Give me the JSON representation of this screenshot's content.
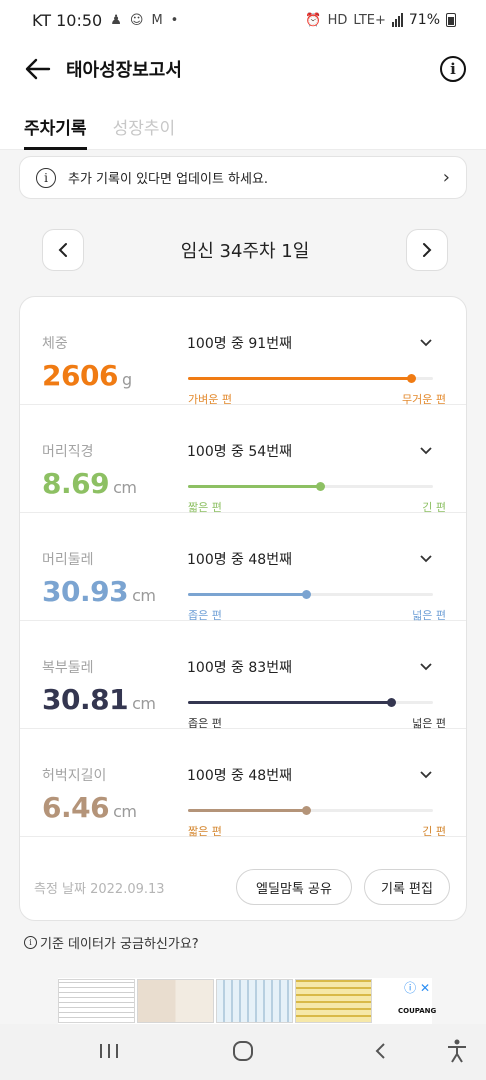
{
  "status_bar": {
    "carrier_time": "KT 10:50",
    "m_label": "M",
    "dot": "•",
    "lte": "LTE+",
    "battery": "71%"
  },
  "header": {
    "title": "태아성장보고서",
    "info": "i"
  },
  "tabs": [
    {
      "label": "주차기록",
      "active": true
    },
    {
      "label": "성장추이",
      "active": false
    }
  ],
  "notice": {
    "icon": "i",
    "text": "추가 기록이 있다면 업데이트 하세요."
  },
  "week_nav": {
    "label": "임신 34주차 1일"
  },
  "metrics": [
    {
      "label": "체중",
      "value": "2606",
      "unit": "g",
      "rank_text": "100명 중 91번째",
      "rank": 91,
      "low": "가벼운 편",
      "high": "무거운 편",
      "color": "#f07b13",
      "value_color": "#f07b13",
      "label_color": "#e38a2e"
    },
    {
      "label": "머리직경",
      "value": "8.69",
      "unit": "cm",
      "rank_text": "100명 중 54번째",
      "rank": 54,
      "low": "짧은 편",
      "high": "긴 편",
      "color": "#8dc063",
      "value_color": "#8dc063",
      "label_color": "#8dc063"
    },
    {
      "label": "머리둘레",
      "value": "30.93",
      "unit": "cm",
      "rank_text": "100명 중 48번째",
      "rank": 48,
      "low": "좁은 편",
      "high": "넓은 편",
      "color": "#7ba4d1",
      "value_color": "#7ba4d1",
      "label_color": "#6e9fd6"
    },
    {
      "label": "복부둘레",
      "value": "30.81",
      "unit": "cm",
      "rank_text": "100명 중 83번째",
      "rank": 83,
      "low": "좁은 편",
      "high": "넓은 편",
      "color": "#343650",
      "value_color": "#343650",
      "label_color": "#333333"
    },
    {
      "label": "허벅지길이",
      "value": "6.46",
      "unit": "cm",
      "rank_text": "100명 중 48번째",
      "rank": 48,
      "low": "짧은 편",
      "high": "긴 편",
      "color": "#b49479",
      "value_color": "#b49479",
      "label_color": "#d4862e"
    }
  ],
  "footer": {
    "date": "측정 날짜 2022.09.13",
    "share": "엘딜맘톡 공유",
    "edit": "기록 편집"
  },
  "help": {
    "icon": "i",
    "text": "기준 데이터가 궁금하신가요?"
  },
  "ad": {
    "brand": "COUPANG"
  }
}
